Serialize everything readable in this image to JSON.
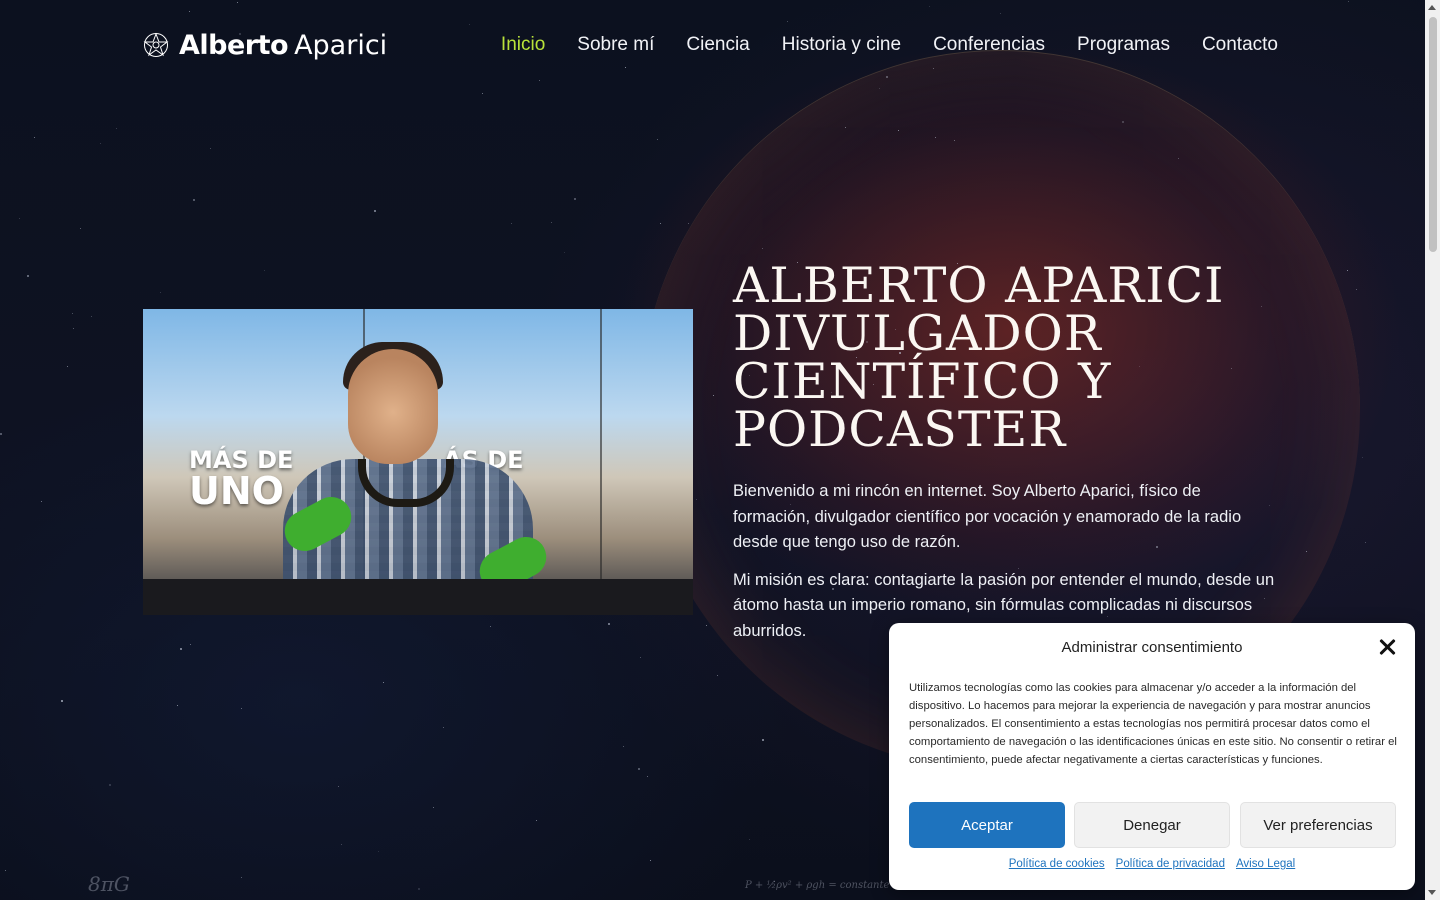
{
  "site": {
    "logo_first": "Alberto",
    "logo_last": "Aparici",
    "logo_icon": "atom-star-icon"
  },
  "nav": {
    "items": [
      {
        "label": "Inicio",
        "active": true
      },
      {
        "label": "Sobre mí",
        "active": false
      },
      {
        "label": "Ciencia",
        "active": false
      },
      {
        "label": "Historia y cine",
        "active": false
      },
      {
        "label": "Conferencias",
        "active": false
      },
      {
        "label": "Programas",
        "active": false
      },
      {
        "label": "Contacto",
        "active": false
      }
    ]
  },
  "hero": {
    "title_line1": "ALBERTO APARICI",
    "title_line2": "DIVULGADOR",
    "title_line3": "CIENTÍFICO Y",
    "title_line4": "PODCASTER",
    "paragraph1": "Bienvenido a mi rincón en internet. Soy Alberto Aparici, físico de formación, divulgador científico por vocación y enamorado de la radio desde que tengo uso de razón.",
    "paragraph2": "Mi misión es clara: contagiarte la pasión por entender el mundo, desde un átomo hasta un imperio romano, sin fórmulas complicadas ni discursos aburridos.",
    "photo_banner_text1": "MÁS DE",
    "photo_banner_text2": "UNO",
    "photo_banner_text3": "ÁS DE"
  },
  "cookie": {
    "title": "Administrar consentimiento",
    "body": "Utilizamos tecnologías como las cookies para almacenar y/o acceder a la información del dispositivo. Lo hacemos para mejorar la experiencia de navegación y para mostrar anuncios personalizados. El consentimiento a estas tecnologías nos permitirá procesar datos como el comportamiento de navegación o las identificaciones únicas en este sitio. No consentir o retirar el consentimiento, puede afectar negativamente a ciertas características y funciones.",
    "accept": "Aceptar",
    "deny": "Denegar",
    "preferences": "Ver preferencias",
    "links": [
      "Política de cookies",
      "Política de privacidad",
      "Aviso Legal"
    ]
  },
  "colors": {
    "accent_nav": "#b9e23a",
    "button_primary": "#1e73be",
    "background": "#0b0f1c"
  }
}
